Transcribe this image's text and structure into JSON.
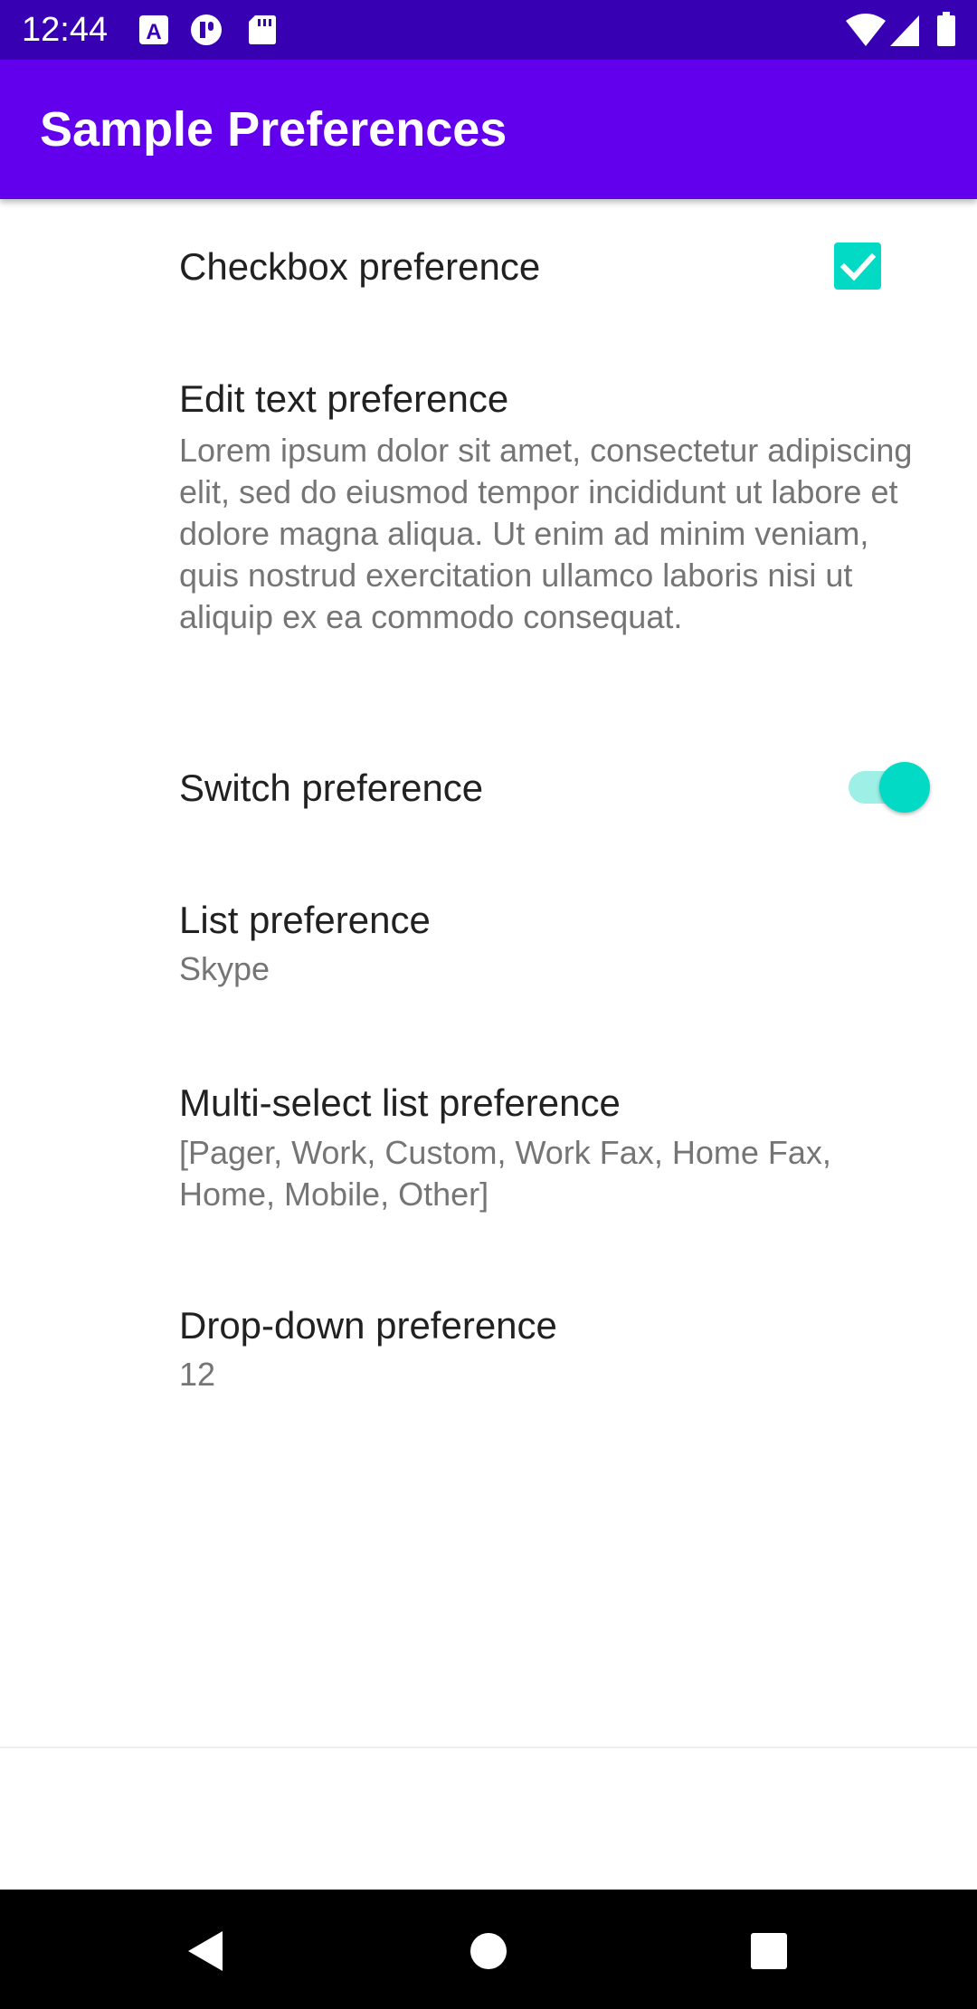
{
  "status_bar": {
    "time": "12:44",
    "notification_icons": [
      "accessibility-a-icon",
      "app-badge-icon",
      "sd-card-icon"
    ],
    "system_icons": [
      "wifi-icon",
      "cell-signal-icon",
      "battery-icon"
    ]
  },
  "app_bar": {
    "title": "Sample Preferences",
    "color": "#6200ee",
    "status_color": "#3700b3"
  },
  "preferences": {
    "checkbox": {
      "title": "Checkbox preference",
      "checked": true
    },
    "edit_text": {
      "title": "Edit text preference",
      "summary": "Lorem ipsum dolor sit amet, consectetur adipiscing elit, sed do eiusmod tempor incididunt ut labore et dolore magna aliqua. Ut enim ad minim veniam, quis nostrud exercitation ullamco laboris nisi ut aliquip ex ea commodo consequat."
    },
    "switch": {
      "title": "Switch preference",
      "on": true
    },
    "list": {
      "title": "List preference",
      "summary": "Skype"
    },
    "multi_select": {
      "title": "Multi-select list preference",
      "summary": "[Pager, Work, Custom, Work Fax, Home Fax, Home, Mobile, Other]"
    },
    "dropdown": {
      "title": "Drop-down preference",
      "summary": "12"
    }
  },
  "accent_color": "#03dac5",
  "nav_bar": {
    "buttons": [
      "back-icon",
      "home-icon",
      "recents-icon"
    ]
  }
}
